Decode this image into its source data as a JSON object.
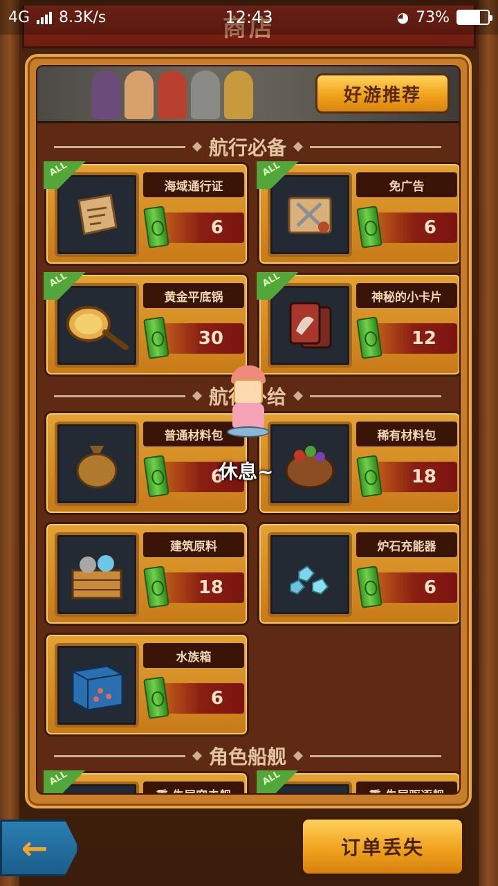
{
  "status_bar": {
    "network": "4G",
    "speed": "8.3K/s",
    "time": "12:43",
    "battery": "73%",
    "battery_level": 0.73
  },
  "header": {
    "title": "商店"
  },
  "banner": {
    "recommend_button": "好游推荐"
  },
  "sections": [
    {
      "title": "航行必备"
    },
    {
      "title": "航行补给"
    },
    {
      "title": "角色船舰"
    }
  ],
  "essentials": [
    {
      "name": "海域通行证",
      "price": "6",
      "badge": "ALL",
      "icon": "map-scroll-icon"
    },
    {
      "name": "免广告",
      "price": "6",
      "badge": "ALL",
      "icon": "sword-scroll-icon"
    },
    {
      "name": "黄金平底锅",
      "price": "30",
      "badge": "ALL",
      "icon": "golden-pan-icon"
    },
    {
      "name": "神秘的小卡片",
      "price": "12",
      "badge": "ALL",
      "icon": "dragon-card-icon"
    }
  ],
  "supplies": [
    {
      "name": "普通材料包",
      "price": "6",
      "icon": "material-bag-icon"
    },
    {
      "name": "稀有材料包",
      "price": "18",
      "icon": "rare-bag-icon"
    },
    {
      "name": "建筑原料",
      "price": "18",
      "icon": "building-crate-icon"
    },
    {
      "name": "炉石充能器",
      "price": "6",
      "icon": "crystal-charger-icon"
    },
    {
      "name": "水族箱",
      "price": "6",
      "icon": "aquarium-icon"
    }
  ],
  "ships_partial": [
    {
      "name": "熏·失尾突击舰",
      "badge": "ALL"
    },
    {
      "name": "熏·失尾驱逐舰",
      "badge": "ALL"
    }
  ],
  "overlay": {
    "rest_text": "休息~"
  },
  "footer": {
    "back_label": "←",
    "order_lost_button": "订单丢失"
  },
  "colors": {
    "panel_gold": "#c77d2a",
    "panel_dark": "#5e2a14",
    "price_red": "#8a1f12",
    "cash_green": "#6fd14a",
    "ribbon_green": "#53a73a"
  }
}
